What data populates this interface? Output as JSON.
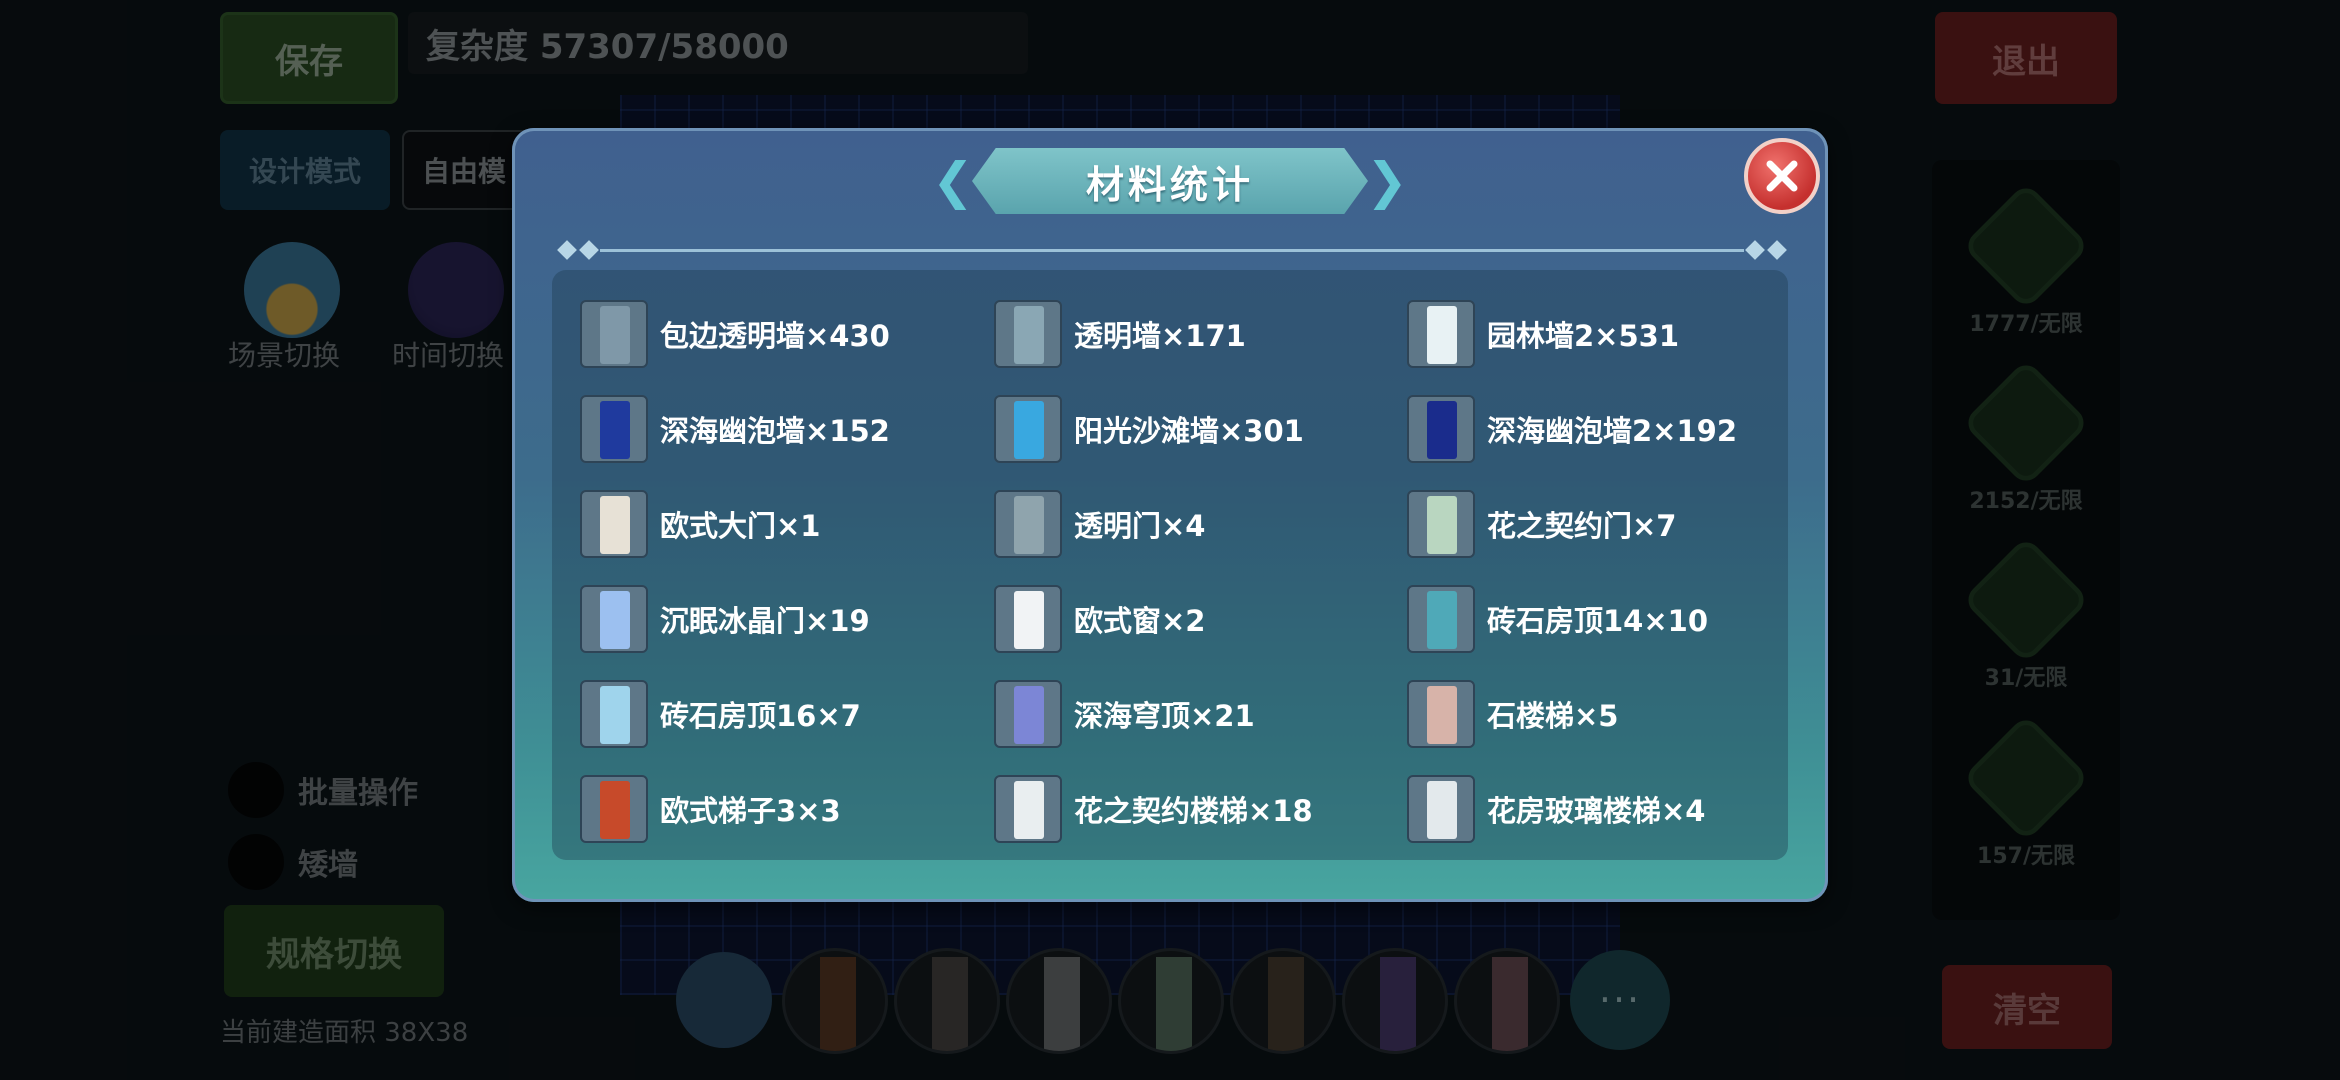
{
  "background": {
    "save_label": "保存",
    "complexity_text": "复杂度 57307/58000",
    "exit_label": "退出",
    "design_mode_label": "设计模式",
    "free_mode_label": "自由模",
    "scene_switch_label": "场景切换",
    "time_switch_label": "时间切换",
    "batch_label": "批量操作",
    "low_wall_label": "矮墙",
    "spec_switch_label": "规格切换",
    "build_area_text": "当前建造面积 38X38",
    "clear_label": "清空",
    "more_label": "···",
    "right_panel": [
      {
        "count": "1777/无限",
        "icon": "wall-category-icon"
      },
      {
        "count": "2152/无限",
        "icon": "floor-category-icon"
      },
      {
        "count": "31/无限",
        "icon": "door-category-icon"
      },
      {
        "count": "157/无限",
        "icon": "pillar-category-icon"
      }
    ]
  },
  "modal": {
    "title": "材料统计",
    "close_icon": "close-icon",
    "items": [
      {
        "label": "包边透明墙×430",
        "icon": "edged-glass-wall-icon",
        "color": "#7f98a8"
      },
      {
        "label": "透明墙×171",
        "icon": "glass-wall-icon",
        "color": "#8aa7b4"
      },
      {
        "label": "园林墙2×531",
        "icon": "garden-wall-icon",
        "color": "#e8f2f4"
      },
      {
        "label": "深海幽泡墙×152",
        "icon": "deep-sea-bubble-wall-icon",
        "color": "#1f3a9e"
      },
      {
        "label": "阳光沙滩墙×301",
        "icon": "sunny-beach-wall-icon",
        "color": "#39a8e0"
      },
      {
        "label": "深海幽泡墙2×192",
        "icon": "deep-sea-bubble-wall-2-icon",
        "color": "#1a2c8c"
      },
      {
        "label": "欧式大门×1",
        "icon": "european-gate-icon",
        "color": "#e7e1d6"
      },
      {
        "label": "透明门×4",
        "icon": "glass-door-icon",
        "color": "#8fa4ad"
      },
      {
        "label": "花之契约门×7",
        "icon": "flower-pact-door-icon",
        "color": "#b9d6c0"
      },
      {
        "label": "沉眠冰晶门×19",
        "icon": "slumber-ice-crystal-door-icon",
        "color": "#9cc0f0"
      },
      {
        "label": "欧式窗×2",
        "icon": "european-window-icon",
        "color": "#f1f3f5"
      },
      {
        "label": "砖石房顶14×10",
        "icon": "brick-roof-14-icon",
        "color": "#4fa9b8"
      },
      {
        "label": "砖石房顶16×7",
        "icon": "brick-roof-16-icon",
        "color": "#9fd4ec"
      },
      {
        "label": "深海穹顶×21",
        "icon": "deep-sea-dome-icon",
        "color": "#7c86d6"
      },
      {
        "label": "石楼梯×5",
        "icon": "stone-stairs-icon",
        "color": "#d7b3a9"
      },
      {
        "label": "欧式梯子3×3",
        "icon": "european-ladder-icon",
        "color": "#c74a2a"
      },
      {
        "label": "花之契约楼梯×18",
        "icon": "flower-pact-stairs-icon",
        "color": "#e9eef0"
      },
      {
        "label": "花房玻璃楼梯×4",
        "icon": "greenhouse-glass-stairs-icon",
        "color": "#e3e9ec"
      }
    ]
  },
  "colors": {
    "modal_top": "#40608f",
    "modal_bottom": "#48a6a0",
    "title_banner": "#6db7bd",
    "close_button": "#d5403c"
  }
}
